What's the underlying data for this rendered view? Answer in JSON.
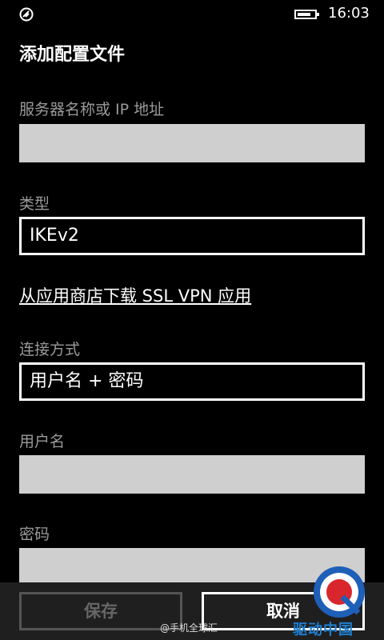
{
  "status_bar": {
    "time": "16:03",
    "battery_level": 0.7
  },
  "page": {
    "title": "添加配置文件"
  },
  "form": {
    "server_label": "服务器名称或 IP 地址",
    "server_value": "",
    "type_label": "类型",
    "type_value": "IKEv2",
    "store_link": "从应用商店下载 SSL VPN 应用",
    "method_label": "连接方式",
    "method_value": "用户名 + 密码",
    "username_label": "用户名",
    "username_value": "",
    "password_label": "密码",
    "password_value": ""
  },
  "app_bar": {
    "save_label": "保存",
    "cancel_label": "取消"
  },
  "watermark": {
    "text": "@手机全球汇",
    "brand": "驱动中国"
  },
  "colors": {
    "background": "#000000",
    "input_fill": "#cfcfcf",
    "label_gray": "#9a9a9a",
    "brand_blue": "#1e7fd0"
  }
}
